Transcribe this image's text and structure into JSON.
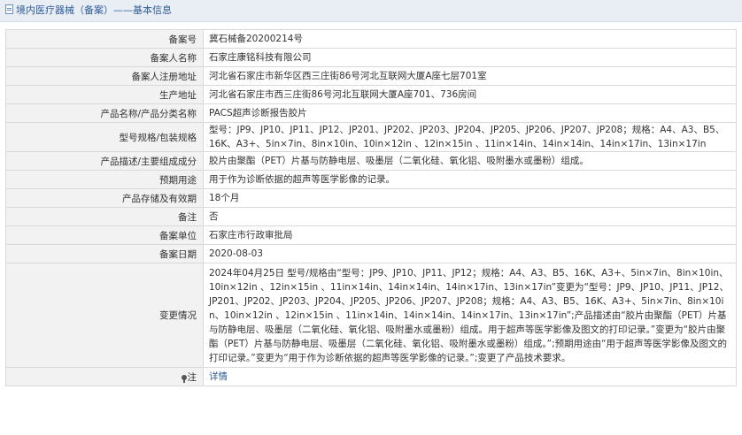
{
  "header": {
    "title": "境内医疗器械（备案）——基本信息"
  },
  "rows": [
    {
      "label": "备案号",
      "value": "冀石械备20200214号"
    },
    {
      "label": "备案人名称",
      "value": "石家庄康铭科技有限公司"
    },
    {
      "label": "备案人注册地址",
      "value": "河北省石家庄市新华区西三庄街86号河北互联网大厦A座七层701室"
    },
    {
      "label": "生产地址",
      "value": "河北省石家庄市西三庄街86号河北互联网大厦A座701、736房间"
    },
    {
      "label": "产品名称/产品分类名称",
      "value": "PACS超声诊断报告胶片"
    },
    {
      "label": "型号规格/包装规格",
      "value": "型号：JP9、JP10、JP11、JP12、JP201、JP202、JP203、JP204、JP205、JP206、JP207、JP208；规格：A4、A3、B5、16K、A3+、5in×7in、8in×10in、10in×12in 、12in×15in 、11in×14in、14in×14in、14in×17in、13in×17in"
    },
    {
      "label": "产品描述/主要组成成分",
      "value": "胶片由聚酯（PET）片基与防静电层、吸墨层（二氧化硅、氧化铝、吸附墨水或墨粉）组成。"
    },
    {
      "label": "预期用途",
      "value": "用于作为诊断依据的超声等医学影像的记录。"
    },
    {
      "label": "产品存储及有效期",
      "value": "18个月"
    },
    {
      "label": "备注",
      "value": "否"
    },
    {
      "label": "备案单位",
      "value": "石家庄市行政审批局"
    },
    {
      "label": "备案日期",
      "value": "2020-08-03"
    },
    {
      "label": "变更情况",
      "value": "2024年04月25日 型号/规格由“型号：JP9、JP10、JP11、JP12；规格：A4、A3、B5、16K、A3+、5in×7in、8in×10in、10in×12in 、12in×15in 、11in×14in、14in×14in、14in×17in、13in×17in”变更为“型号：JP9、JP10、JP11、JP12、JP201、JP202、JP203、JP204、JP205、JP206、JP207、JP208；规格：A4、A3、B5、16K、A3+、5in×7in、8in×10in、10in×12in 、12in×15in 、11in×14in、14in×14in、14in×17in、13in×17in”;产品描述由“胶片由聚酯（PET）片基与防静电层、吸墨层（二氧化硅、氧化铝、吸附墨水或墨粉）组成。用于超声等医学影像及图文的打印记录。”变更为“胶片由聚酯（PET）片基与防静电层、吸墨层（二氧化硅、氧化铝、吸附墨水或墨粉）组成。”;预期用途由“用于超声等医学影像及图文的打印记录。”变更为“用于作为诊断依据的超声等医学影像的记录。”;变更了产品技术要求。"
    },
    {
      "label": "注",
      "value": "详情"
    }
  ]
}
